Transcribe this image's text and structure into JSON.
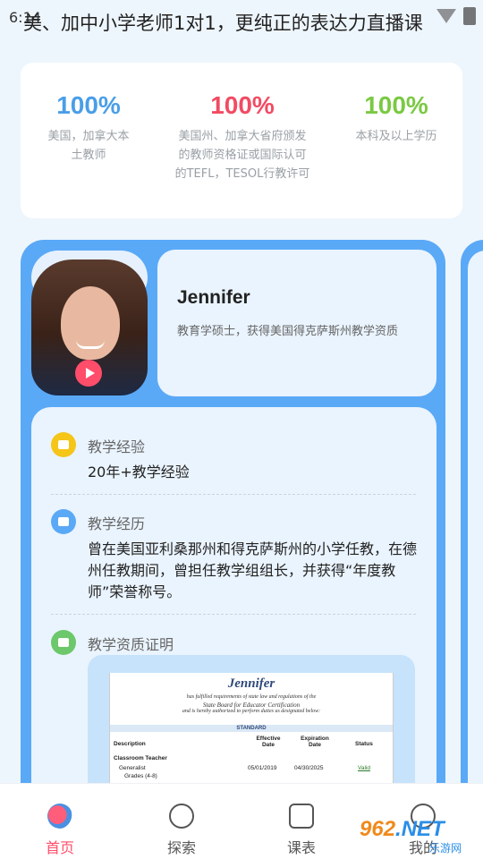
{
  "status_bar": {
    "time": "6:14"
  },
  "headline": "美、加中小学老师1对1，更纯正的表达力直播课",
  "stats": [
    {
      "value": "100%",
      "desc": "美国，加拿大本土教师",
      "color": "#4a9ee8"
    },
    {
      "value": "100%",
      "desc": "美国州、加拿大省府颁发的教师资格证或国际认可的TEFL，TESOL行教许可",
      "color": "#f24b63"
    },
    {
      "value": "100%",
      "desc": "本科及以上学历",
      "color": "#7ac943"
    }
  ],
  "teacher": {
    "name": "Jennifer",
    "degree": "教育学硕士，获得美国得克萨斯州教学资质",
    "sections": [
      {
        "icon": "experience-icon",
        "title": "教学经验",
        "body": "20年+教学经验",
        "color": "#f5c518"
      },
      {
        "icon": "history-icon",
        "title": "教学经历",
        "body": "曾在美国亚利桑那州和得克萨斯州的小学任教，在德州任教期间，曾担任教学组组长，并获得“年度教师”荣誉称号。",
        "color": "#5aa9f7"
      },
      {
        "icon": "certificate-icon",
        "title": "教学资质证明",
        "body": "",
        "color": "#6cc86a"
      }
    ],
    "certificate": {
      "name": "Jennifer",
      "line1": "has fulfilled requirements of state law and regulations of the",
      "line2": "State Board for Educator Certification",
      "line3": "and is hereby authorized to perform duties as designated below:",
      "standard": "STANDARD",
      "headers": {
        "description": "Description",
        "effective": "Effective Date",
        "expiration": "Expiration Date",
        "status": "Status"
      },
      "category": "Classroom Teacher",
      "row": {
        "subject": "Generalist",
        "grades": "Grades (4-8)",
        "effective": "05/01/2019",
        "expiration": "04/30/2025",
        "status": "Valid"
      }
    }
  },
  "tabbar": [
    {
      "label": "首页",
      "icon": "home-parrot-icon",
      "active": true
    },
    {
      "label": "探索",
      "icon": "planet-icon",
      "active": false
    },
    {
      "label": "课表",
      "icon": "calendar-icon",
      "active": false
    },
    {
      "label": "我的",
      "icon": "profile-icon",
      "active": false
    }
  ],
  "watermark": {
    "logo_num": "962",
    "logo_suffix": ".NET",
    "sub": "乐游网"
  }
}
